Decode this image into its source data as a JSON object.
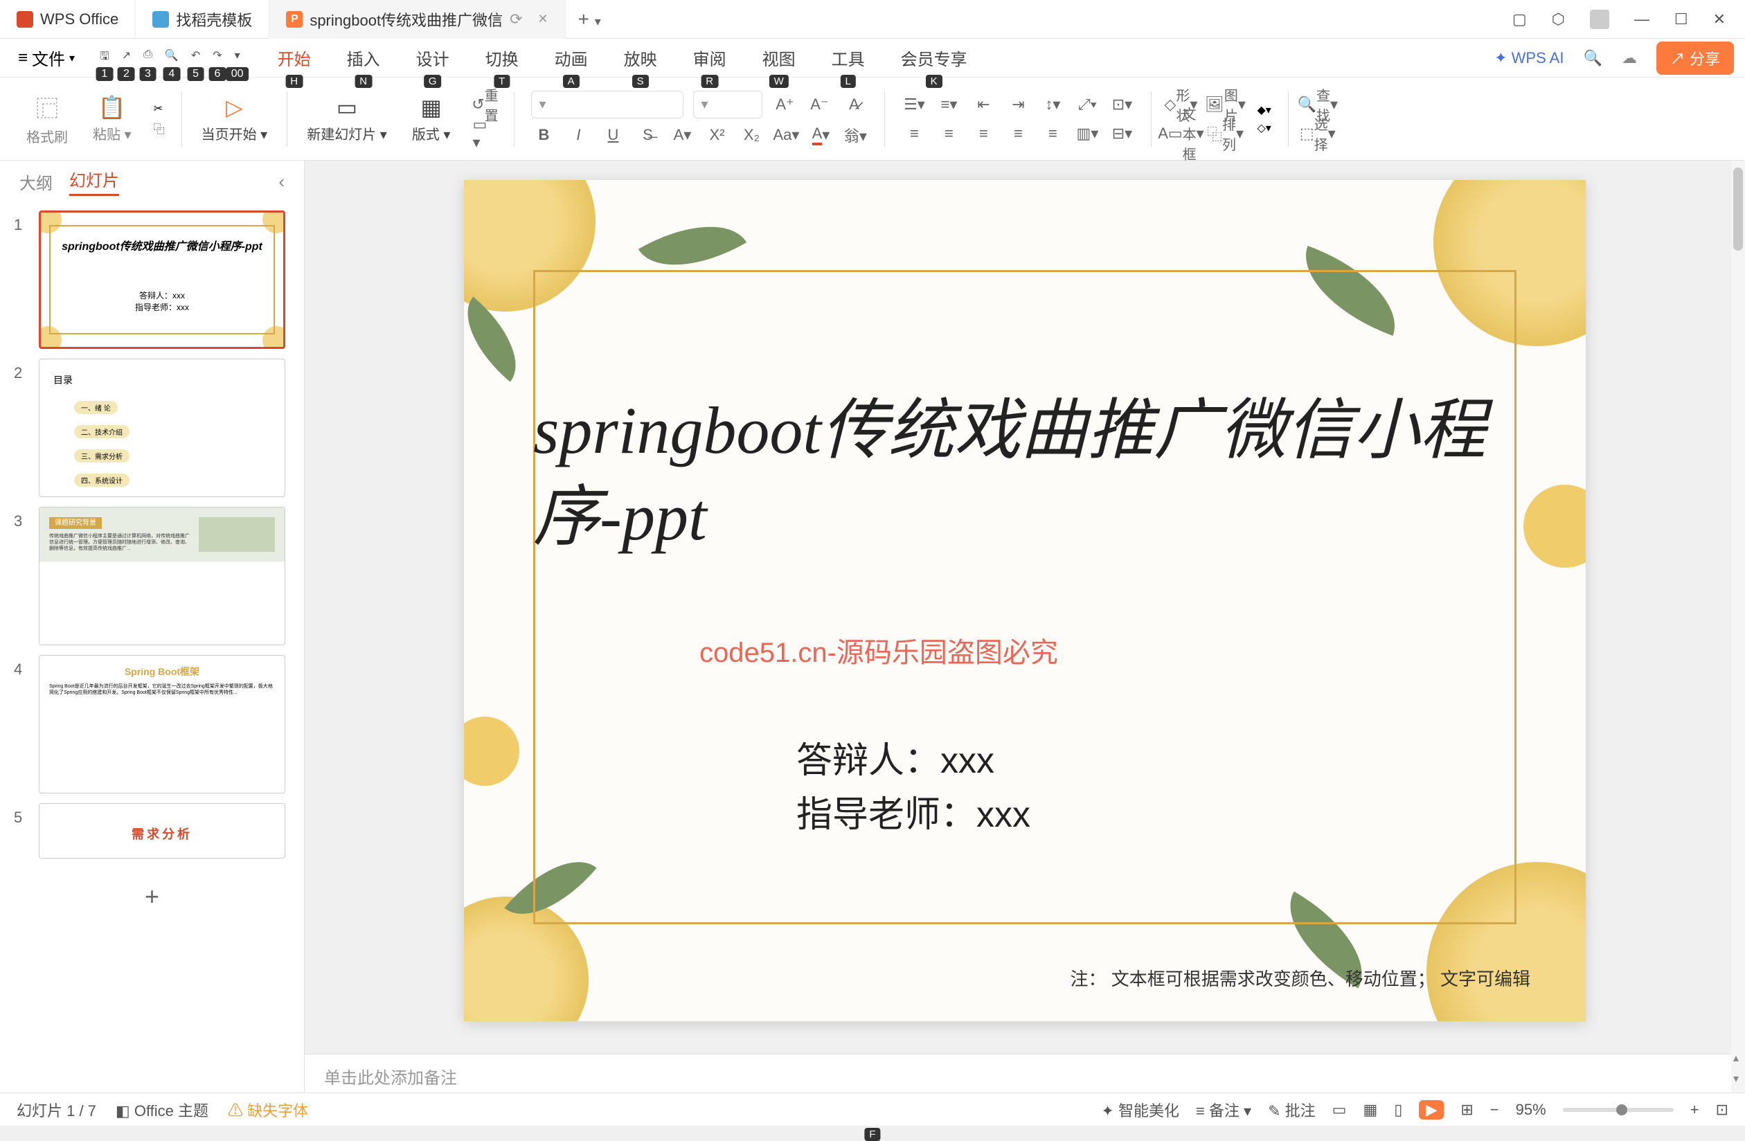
{
  "titlebar": {
    "tabs": [
      {
        "icon_color": "#d94a2b",
        "label": "WPS Office"
      },
      {
        "icon_color": "#4aa3d9",
        "label": "找稻壳模板"
      },
      {
        "icon_color": "#ff7a3d",
        "label": "springboot传统戏曲推广微信",
        "active": true
      }
    ],
    "add": "+"
  },
  "menu": {
    "file": "文件",
    "file_key": "F",
    "qat_keys": [
      "1",
      "2",
      "3",
      "4",
      "5",
      "6",
      "00"
    ],
    "tabs": [
      {
        "label": "开始",
        "key": "H",
        "active": true
      },
      {
        "label": "插入",
        "key": "N"
      },
      {
        "label": "设计",
        "key": "G"
      },
      {
        "label": "切换",
        "key": "T"
      },
      {
        "label": "动画",
        "key": "A"
      },
      {
        "label": "放映",
        "key": "S"
      },
      {
        "label": "审阅",
        "key": "R"
      },
      {
        "label": "视图",
        "key": "W"
      },
      {
        "label": "工具",
        "key": "L"
      },
      {
        "label": "会员专享",
        "key": "K"
      }
    ],
    "ai": "WPS AI",
    "share": "分享"
  },
  "ribbon": {
    "format_painter": "格式刷",
    "paste": "粘贴",
    "from_current": "当页开始",
    "new_slide": "新建幻灯片",
    "layout": "版式",
    "reset": "重置",
    "shape": "形状",
    "picture": "图片",
    "textbox": "文本框",
    "arrange": "排列",
    "find": "查找",
    "select": "选择"
  },
  "side": {
    "outline": "大纲",
    "slides": "幻灯片"
  },
  "thumbs": {
    "t1_title": "springboot传统戏曲推广微信小程序-ppt",
    "t1_presenter": "答辩人：xxx",
    "t1_teacher": "指导老师：xxx",
    "t2_title": "目录",
    "t2_items": [
      "一、绪 论",
      "二、技术介绍",
      "三、需求分析",
      "四、系统设计"
    ],
    "t3_head": "课题研究背景",
    "t4_head": "Spring Boot框架",
    "t5_head": "需求分析"
  },
  "slide": {
    "title": "springboot传统戏曲推广微信小程序-ppt",
    "presenter": "答辩人：xxx",
    "teacher": "指导老师：xxx",
    "note": "注： 文本框可根据需求改变颜色、移动位置； 文字可编辑",
    "watermark": "code51.cn-源码乐园盗图必究"
  },
  "notes_placeholder": "单击此处添加备注",
  "status": {
    "slide_count": "幻灯片 1 / 7",
    "theme": "Office 主题",
    "missing_font": "缺失字体",
    "beautify": "智能美化",
    "notes": "备注",
    "comments": "批注",
    "zoom": "95%"
  }
}
